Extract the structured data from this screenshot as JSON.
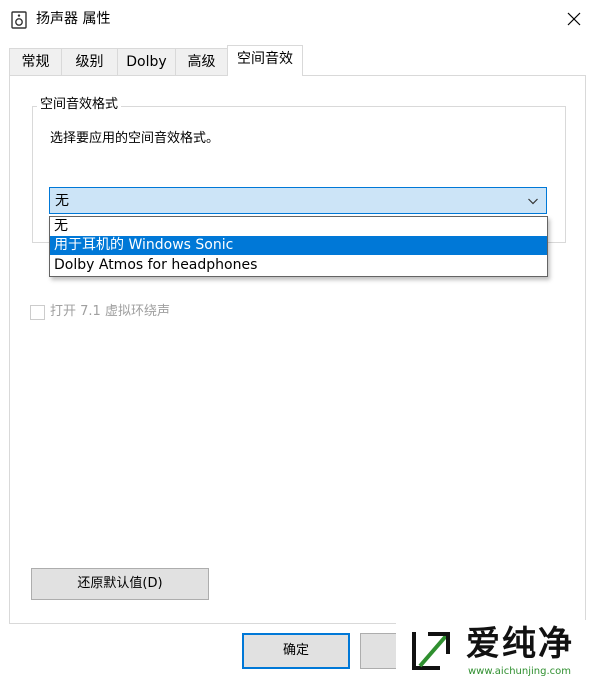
{
  "window": {
    "title": "扬声器 属性",
    "close_glyph": "✕"
  },
  "tabs": [
    {
      "label": "常规"
    },
    {
      "label": "级别"
    },
    {
      "label": "Dolby"
    },
    {
      "label": "高级"
    },
    {
      "label": "空间音效",
      "active": true
    }
  ],
  "spatial": {
    "group_title": "空间音效格式",
    "description": "选择要应用的空间音效格式。",
    "selected_value": "无",
    "options": [
      {
        "label": "无"
      },
      {
        "label": "用于耳机的 Windows Sonic",
        "highlighted": true
      },
      {
        "label": "Dolby Atmos for headphones"
      }
    ],
    "virtual_surround_label": "打开 7.1 虚拟环绕声",
    "virtual_surround_checked": false
  },
  "buttons": {
    "restore_label": "还原默认值(D)",
    "ok_label": "确定",
    "cancel_label": ""
  },
  "watermark": {
    "text": "爱纯净",
    "url": "www.aichunjing.com"
  },
  "colors": {
    "accent": "#0078d7",
    "combo_bg": "#cce4f7",
    "watermark_green": "#2f8f2f"
  }
}
